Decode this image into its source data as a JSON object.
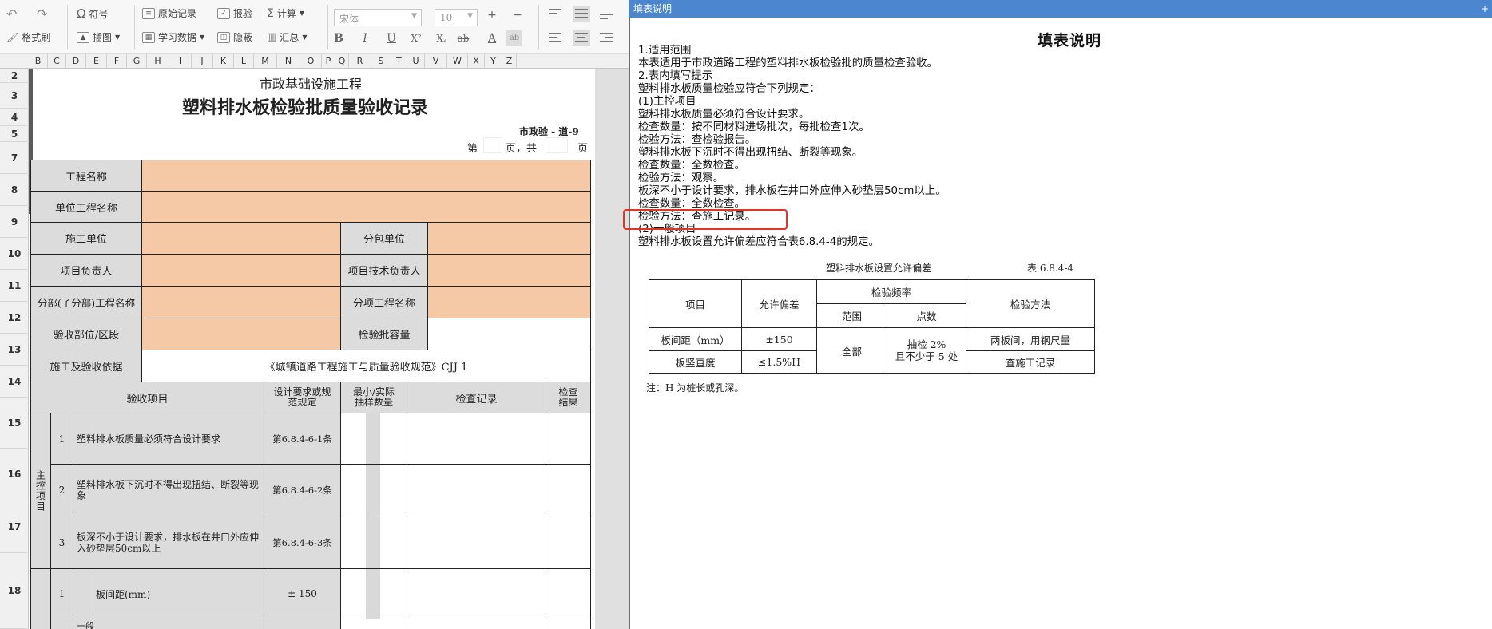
{
  "toolbar": {
    "undo_icon": "undo-icon",
    "redo_icon": "redo-icon",
    "symbol": "符号",
    "format_painter": "格式刷",
    "raw_record": "原始记录",
    "insert_image": "插图",
    "learn_data": "学习数据",
    "report": "报验",
    "hide": "隐蔽",
    "calculate": "计算",
    "summary": "汇总",
    "font_name": "宋体",
    "font_size": "10",
    "plus": "+",
    "minus": "−",
    "bold": "B",
    "italic": "I",
    "underline": "U",
    "superscript": "X²",
    "subscript": "X₂",
    "strikethrough": "ab",
    "font_color": "A",
    "char_border": "ab"
  },
  "sheet": {
    "columns": [
      "B",
      "C",
      "D",
      "E",
      "F",
      "G",
      "H",
      "I",
      "J",
      "K",
      "L",
      "M",
      "N",
      "O",
      "P",
      "Q",
      "R",
      "S",
      "T",
      "U",
      "V",
      "W",
      "X",
      "Y",
      "Z"
    ],
    "rows": [
      "2",
      "3",
      "4",
      "5",
      "7",
      "8",
      "9",
      "10",
      "11",
      "12",
      "13",
      "14",
      "15",
      "16",
      "17",
      "18"
    ],
    "subtitle": "市政基础设施工程",
    "title": "塑料排水板检验批质量验收记录",
    "code": "市政验 - 道-9",
    "page_prefix": "第",
    "page_mid": "页，共",
    "page_suffix": "页",
    "fields": {
      "project_name": "工程名称",
      "unit_project_name": "单位工程名称",
      "construction_unit": "施工单位",
      "subcontract_unit": "分包单位",
      "project_manager": "项目负责人",
      "tech_manager": "项目技术负责人",
      "subdivision_name": "分部(子分部)工程名称",
      "subitem_name": "分项工程名称",
      "acceptance_part": "验收部位/区段",
      "batch_capacity": "检验批容量",
      "basis_label": "施工及验收依据",
      "basis_value": "《城镇道路工程施工与质量验收规范》CJJ 1"
    },
    "table_header": {
      "item": "验收项目",
      "spec": "设计要求或规范规定",
      "sample": "最小/实际抽样数量",
      "record": "检查记录",
      "result": "检查结果"
    },
    "main_control": "主控项目",
    "general_partial": "一般",
    "items": [
      {
        "no": "1",
        "desc": "塑料排水板质量必须符合设计要求",
        "spec": "第6.8.4-6-1条",
        "sample": "/"
      },
      {
        "no": "2",
        "desc": "塑料排水板下沉时不得出现扭结、断裂等现象",
        "spec": "第6.8.4-6-2条",
        "sample": "/"
      },
      {
        "no": "3",
        "desc": "板深不小于设计要求，排水板在井口外应伸入砂垫层50cm以上",
        "spec": "第6.8.4-6-3条",
        "sample": "/"
      },
      {
        "no": "1",
        "desc": "板间距(mm)",
        "spec": "± 150",
        "sample": "/"
      }
    ]
  },
  "panel": {
    "window_title": "填表说明",
    "pin": "+",
    "title": "填表说明",
    "lines": [
      "1.适用范围",
      "本表适用于市政道路工程的塑料排水板检验批的质量检查验收。",
      "2.表内填写提示",
      "塑料排水板质量检验应符合下列规定：",
      "(1)主控项目",
      "塑料排水板质量必须符合设计要求。",
      "检查数量：按不同材料进场批次，每批检查1次。",
      "检验方法：查检验报告。",
      "塑料排水板下沉时不得出现扭结、断裂等现象。",
      "检查数量：全数检查。",
      "检验方法：观察。",
      "板深不小于设计要求，排水板在井口外应伸入砂垫层50cm以上。",
      "检查数量：全数检查。",
      "检验方法：查施工记录。",
      "(2)一般项目",
      "塑料排水板设置允许偏差应符合表6.8.4-4的规定。"
    ],
    "table_title": "塑料排水板设置允许偏差",
    "table_no": "表 6.8.4-4",
    "table": {
      "h_item": "项目",
      "h_tol": "允许偏差",
      "h_freq": "检验频率",
      "h_range": "范围",
      "h_points": "点数",
      "h_method": "检验方法",
      "r1_item": "板间距（mm）",
      "r1_tol": "±150",
      "range_all": "全部",
      "points": "抽检 2%\n且不少于 5 处",
      "r1_method": "两板间，用钢尺量",
      "r2_item": "板竖直度",
      "r2_tol": "≤1.5%H",
      "r2_method": "查施工记录"
    },
    "note": "注：H 为桩长或孔深。"
  }
}
